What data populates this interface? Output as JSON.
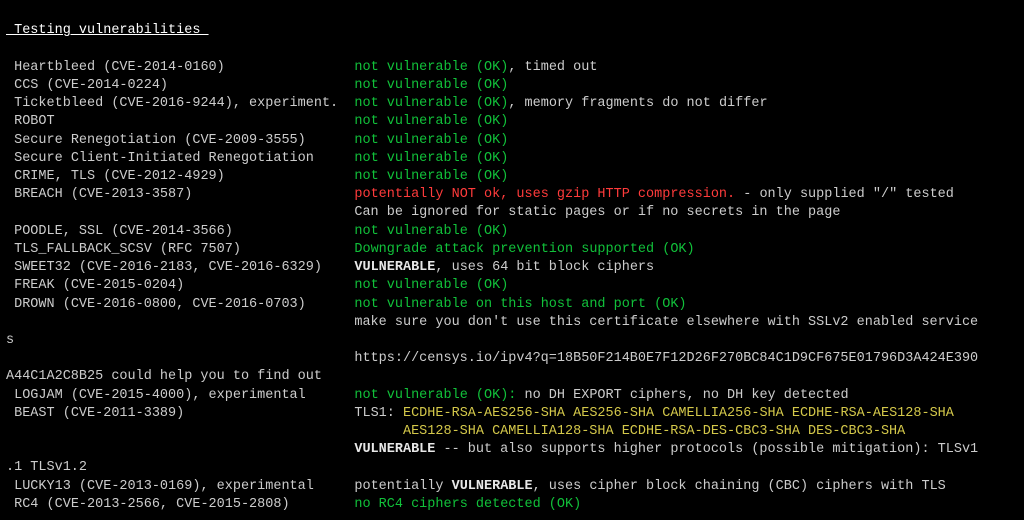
{
  "header": " Testing vulnerabilities ",
  "rows": [
    {
      "name": "Heartbleed (CVE-2014-0160)                ",
      "status": "not vulnerable (OK)",
      "extra": ", timed out"
    },
    {
      "name": "CCS (CVE-2014-0224)                       ",
      "status": "not vulnerable (OK)"
    },
    {
      "name": "Ticketbleed (CVE-2016-9244), experiment.  ",
      "status": "not vulnerable (OK)",
      "extra": ", memory fragments do not differ"
    },
    {
      "name": "ROBOT                                     ",
      "status": "not vulnerable (OK)"
    },
    {
      "name": "Secure Renegotiation (CVE-2009-3555)      ",
      "status": "not vulnerable (OK)"
    },
    {
      "name": "Secure Client-Initiated Renegotiation     ",
      "status": "not vulnerable (OK)"
    },
    {
      "name": "CRIME, TLS (CVE-2012-4929)                ",
      "status": "not vulnerable (OK)"
    },
    {
      "name": "BREACH (CVE-2013-3587)                    ",
      "status": "potentially NOT ok, uses gzip HTTP compression.",
      "extra": " - only supplied \"/\" tested",
      "cont": "                                           Can be ignored for static pages or if no secrets in the page"
    },
    {
      "name": "POODLE, SSL (CVE-2014-3566)               ",
      "status": "not vulnerable (OK)"
    },
    {
      "name": "TLS_FALLBACK_SCSV (RFC 7507)              ",
      "status": "Downgrade attack prevention supported (OK)"
    },
    {
      "name": "SWEET32 (CVE-2016-2183, CVE-2016-6329)    ",
      "status": "VULNERABLE",
      "extra": ", uses 64 bit block ciphers"
    },
    {
      "name": "FREAK (CVE-2015-0204)                     ",
      "status": "not vulnerable (OK)"
    },
    {
      "name": "DROWN (CVE-2016-0800, CVE-2016-0703)      ",
      "status": "not vulnerable on this host and port (OK)",
      "cont": "                                           make sure you don't use this certificate elsewhere with SSLv2 enabled service",
      "cont2": "s",
      "cont3": "                                           https://censys.io/ipv4?q=18B50F214B0E7F12D26F270BC84C1D9CF675E01796D3A424E390",
      "tail": "A44C1A2C8B25 could help you to find out"
    },
    {
      "name": "LOGJAM (CVE-2015-4000), experimental      ",
      "status": "not vulnerable (OK):",
      "extra": " no DH EXPORT ciphers, no DH key detected"
    },
    {
      "name": "BEAST (CVE-2011-3389)                     ",
      "lead": "TLS1: ",
      "ciphers": "ECDHE-RSA-AES256-SHA AES256-SHA CAMELLIA256-SHA ECDHE-RSA-AES128-SHA",
      "ciphers2": "                                                 AES128-SHA CAMELLIA128-SHA ECDHE-RSA-DES-CBC3-SHA DES-CBC3-SHA",
      "pad": "                                           ",
      "vstatus": "VULNERABLE",
      "extra": " -- but also supports higher protocols (possible mitigation): TLSv1",
      "tail": ".1 TLSv1.2"
    },
    {
      "name": "LUCKY13 (CVE-2013-0169), experimental     ",
      "lead": "potentially ",
      "status": "VULNERABLE",
      "extra": ", uses cipher block chaining (CBC) ciphers with TLS"
    },
    {
      "name": "RC4 (CVE-2013-2566, CVE-2015-2808)        ",
      "status": "no RC4 ciphers detected (OK)"
    }
  ]
}
